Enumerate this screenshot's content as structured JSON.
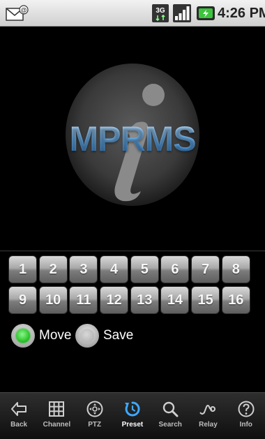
{
  "status_bar": {
    "time": "4:26 PM",
    "icons": [
      "mail-icon",
      "3g-icon",
      "signal-icon",
      "battery-icon"
    ]
  },
  "logo": {
    "text": "MPRMS",
    "colors": {
      "text": "#5aa9e8",
      "badge": "#3a3a3a"
    }
  },
  "presets": {
    "buttons": [
      "1",
      "2",
      "3",
      "4",
      "5",
      "6",
      "7",
      "8",
      "9",
      "10",
      "11",
      "12",
      "13",
      "14",
      "15",
      "16"
    ]
  },
  "mode": {
    "options": [
      {
        "label": "Move",
        "selected": true
      },
      {
        "label": "Save",
        "selected": false
      }
    ]
  },
  "tabs": [
    {
      "label": "Back",
      "icon": "back-arrow-icon",
      "active": false
    },
    {
      "label": "Channel",
      "icon": "grid-icon",
      "active": false
    },
    {
      "label": "PTZ",
      "icon": "ptz-icon",
      "active": false
    },
    {
      "label": "Preset",
      "icon": "preset-icon",
      "active": true
    },
    {
      "label": "Search",
      "icon": "search-icon",
      "active": false
    },
    {
      "label": "Relay",
      "icon": "relay-icon",
      "active": false
    },
    {
      "label": "Info",
      "icon": "info-icon",
      "active": false
    }
  ],
  "colors": {
    "tab_active": "#3fa9ff",
    "tab_inactive": "#bdbdbd"
  }
}
